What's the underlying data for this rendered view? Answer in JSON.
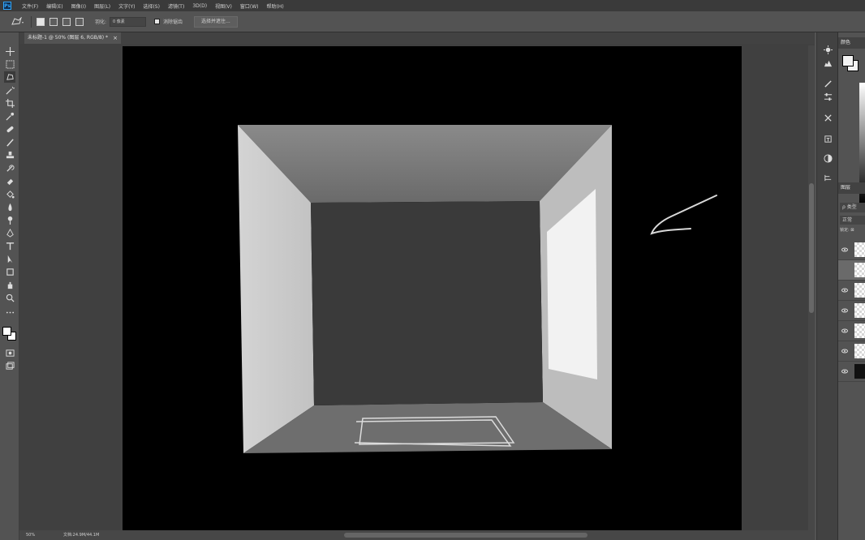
{
  "menubar": {
    "items": [
      "文件(F)",
      "编辑(E)",
      "图像(I)",
      "图层(L)",
      "文字(Y)",
      "选择(S)",
      "滤镜(T)",
      "3D(D)",
      "视图(V)",
      "窗口(W)",
      "帮助(H)"
    ]
  },
  "options": {
    "feather_label": "羽化:",
    "feather_value": "0 像素",
    "antialias_label": "消除锯齿",
    "select_mask_button": "选择并遮住..."
  },
  "document": {
    "tab_title": "未标题-1 @ 50% (图层 6, RGB/8) *",
    "tab_close": "×"
  },
  "status": {
    "zoom": "50%",
    "doc_size": "文档:24.9M/44.1M"
  },
  "panels": {
    "color_tab": "颜色",
    "layers_tab": "图层",
    "layer_search": "ρ 类型",
    "blend_mode": "正常",
    "lock_label": "锁定: ⊠"
  },
  "tools": [
    "move-icon",
    "marquee-icon",
    "lasso-icon",
    "magic-wand-icon",
    "crop-icon",
    "eyedropper-icon",
    "healing-brush-icon",
    "brush-icon",
    "clone-stamp-icon",
    "history-brush-icon",
    "eraser-icon",
    "paint-bucket-icon",
    "blur-icon",
    "dodge-icon",
    "pen-icon",
    "type-icon",
    "path-selection-icon",
    "shape-icon",
    "hand-icon",
    "zoom-icon",
    "more-tools-icon"
  ],
  "colors": {
    "workspace": "#404040",
    "canvas": "#000000",
    "ui_dark": "#3a3a3a",
    "ui_mid": "#535353",
    "accent": "#31a8ff"
  }
}
